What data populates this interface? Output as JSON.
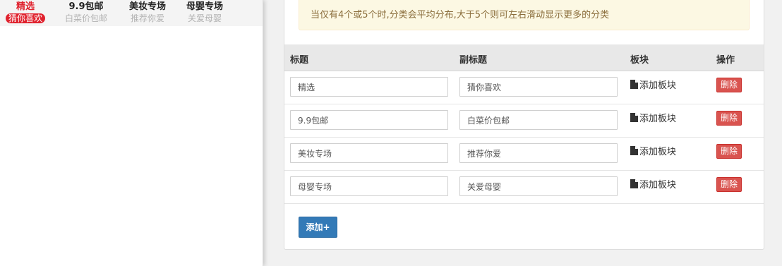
{
  "preview": {
    "categories": [
      {
        "name": "精选",
        "subtitle": "猜你喜欢",
        "active": true
      },
      {
        "name": "9.9包邮",
        "subtitle": "白菜价包邮",
        "active": false
      },
      {
        "name": "美妆专场",
        "subtitle": "推荐你爱",
        "active": false
      },
      {
        "name": "母婴专场",
        "subtitle": "关爱母婴",
        "active": false
      }
    ]
  },
  "tip": "当仅有4个或5个时,分类会平均分布,大于5个则可左右滑动显示更多的分类",
  "table": {
    "headers": {
      "title": "标题",
      "subtitle": "副标题",
      "block": "板块",
      "action": "操作"
    },
    "rows": [
      {
        "title": "精选",
        "subtitle": "猜你喜欢",
        "block_label": "添加板块",
        "delete_label": "删除"
      },
      {
        "title": "9.9包邮",
        "subtitle": "白菜价包邮",
        "block_label": "添加板块",
        "delete_label": "删除"
      },
      {
        "title": "美妆专场",
        "subtitle": "推荐你爱",
        "block_label": "添加板块",
        "delete_label": "删除"
      },
      {
        "title": "母婴专场",
        "subtitle": "关爱母婴",
        "block_label": "添加板块",
        "delete_label": "删除"
      }
    ]
  },
  "add_button": "添加+",
  "icons": {
    "block": "file-icon"
  },
  "colors": {
    "active_red": "#e0222e",
    "danger": "#d9534f",
    "primary": "#337ab7",
    "tip_bg": "#fcf8e3"
  }
}
